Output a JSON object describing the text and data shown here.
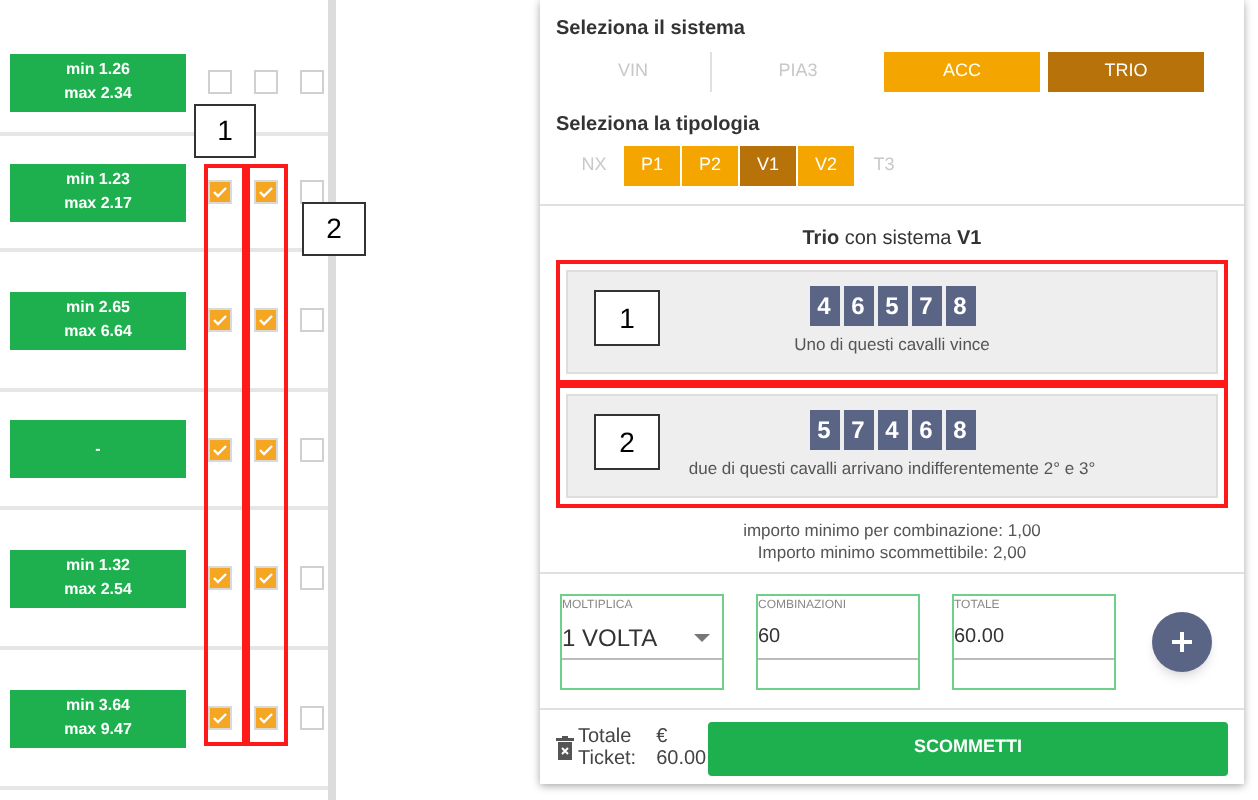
{
  "odds_list": {
    "rows": [
      {
        "odds": [
          "min 1.26",
          "max 2.34"
        ],
        "checks": [
          false,
          false,
          false
        ]
      },
      {
        "odds": [
          "min 1.23",
          "max 2.17"
        ],
        "checks": [
          true,
          true,
          false
        ]
      },
      {
        "odds": [
          "min 2.65",
          "max 6.64"
        ],
        "checks": [
          true,
          true,
          false
        ]
      },
      {
        "odds": [
          "-"
        ],
        "checks": [
          true,
          true,
          false
        ]
      },
      {
        "odds": [
          "min 1.32",
          "max 2.54"
        ],
        "checks": [
          true,
          true,
          false
        ]
      },
      {
        "odds": [
          "min 3.64",
          "max 9.47"
        ],
        "checks": [
          true,
          true,
          false
        ]
      }
    ],
    "callouts": [
      "1",
      "2"
    ]
  },
  "bet_panel": {
    "system_title": "Seleziona il sistema",
    "systems": [
      {
        "label": "VIN",
        "disabled": true,
        "selected": false
      },
      {
        "label": "PIA3",
        "disabled": true,
        "selected": false
      },
      {
        "label": "ACC",
        "disabled": false,
        "selected": false
      },
      {
        "label": "TRIO",
        "disabled": false,
        "selected": true
      }
    ],
    "type_title": "Seleziona la tipologia",
    "types": [
      {
        "label": "NX",
        "disabled": true,
        "selected": false
      },
      {
        "label": "P1",
        "disabled": false,
        "selected": false
      },
      {
        "label": "P2",
        "disabled": false,
        "selected": false
      },
      {
        "label": "V1",
        "disabled": false,
        "selected": true
      },
      {
        "label": "V2",
        "disabled": false,
        "selected": false
      },
      {
        "label": "T3",
        "disabled": true,
        "selected": false
      }
    ],
    "heading": "**Trio** con sistema **V1**",
    "groups": [
      {
        "callout": "1",
        "horses": [
          "4",
          "6",
          "5",
          "7",
          "8"
        ],
        "caption": "Uno di questi cavalli vince"
      },
      {
        "callout": "2",
        "horses": [
          "5",
          "7",
          "4",
          "6",
          "8"
        ],
        "caption": "due di questi cavalli arrivano indifferentemente 2° e 3°"
      }
    ],
    "min_notes": [
      "importo minimo per combinazione: 1,00",
      "Importo minimo scommettibile: 2,00"
    ],
    "fields": [
      {
        "kind": "select",
        "label": "MOLTIPLICA",
        "value": "1 VOLTA"
      },
      {
        "kind": "input",
        "label": "COMBINAZIONI",
        "value": "60"
      },
      {
        "kind": "input",
        "label": "TOTALE",
        "value": "60.00"
      }
    ],
    "total_label": [
      "Totale",
      "Ticket:"
    ],
    "total_value": [
      "€",
      "60.00"
    ],
    "submit": "SCOMMETTI"
  }
}
